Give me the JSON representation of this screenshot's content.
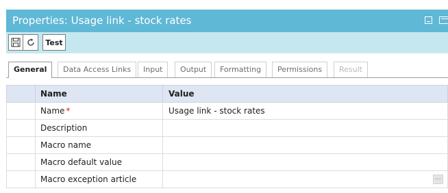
{
  "window": {
    "title": "Properties: Usage link - stock rates"
  },
  "toolbar": {
    "save_icon": "save-icon",
    "refresh_icon": "refresh-icon",
    "test_label": "Test"
  },
  "tabs": [
    {
      "label": "General",
      "state": "active"
    },
    {
      "label": "Data Access Links",
      "state": "normal"
    },
    {
      "label": "Input",
      "state": "normal"
    },
    {
      "label": "Output",
      "state": "normal"
    },
    {
      "label": "Formatting",
      "state": "normal"
    },
    {
      "label": "Permissions",
      "state": "normal"
    },
    {
      "label": "Result",
      "state": "disabled"
    }
  ],
  "grid": {
    "headers": {
      "name": "Name",
      "value": "Value"
    },
    "rows": [
      {
        "name": "Name",
        "required": "*",
        "value": "Usage link - stock rates"
      },
      {
        "name": "Description",
        "value": ""
      },
      {
        "name": "Macro name",
        "value": ""
      },
      {
        "name": "Macro default value",
        "value": ""
      },
      {
        "name": "Macro exception article",
        "value": "",
        "action": "..."
      }
    ]
  },
  "colors": {
    "titlebar": "#5fb8d6",
    "toolbar": "#c5e8f0",
    "header": "#dde6f2",
    "required": "#d32020"
  }
}
